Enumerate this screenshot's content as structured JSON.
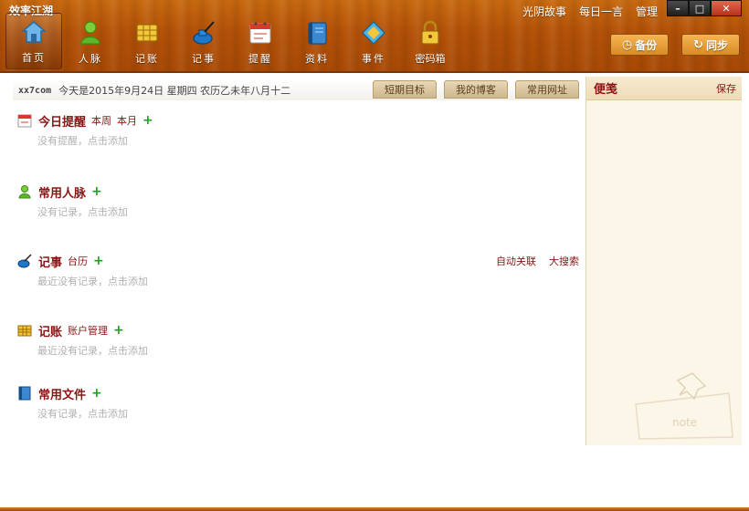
{
  "app": {
    "title": "效率江湖"
  },
  "top_links": [
    "光阴故事",
    "每日一言",
    "管理"
  ],
  "window_controls": {
    "minimize": "–",
    "maximize": "□",
    "close": "✕"
  },
  "nav": [
    {
      "label": "首页",
      "icon": "home-icon"
    },
    {
      "label": "人脉",
      "icon": "contacts-person-icon"
    },
    {
      "label": "记账",
      "icon": "ledger-icon"
    },
    {
      "label": "记事",
      "icon": "ink-bottle-icon"
    },
    {
      "label": "提醒",
      "icon": "calendar-icon"
    },
    {
      "label": "资料",
      "icon": "book-icon"
    },
    {
      "label": "事件",
      "icon": "diamond-icon"
    },
    {
      "label": "密码箱",
      "icon": "lock-icon"
    }
  ],
  "actions": {
    "backup": "备份",
    "sync": "同步"
  },
  "info": {
    "user": "xx7com",
    "date_text": "今天是2015年9月24日 星期四 农历乙未年八月十二"
  },
  "tabs": [
    "短期目标",
    "我的博客",
    "常用网址"
  ],
  "sections": {
    "reminder": {
      "title": "今日提醒",
      "links": [
        "本周",
        "本月"
      ],
      "empty": "没有提醒，点击添加"
    },
    "contacts": {
      "title": "常用人脉",
      "empty": "没有记录，点击添加"
    },
    "notes": {
      "title": "记事",
      "link": "台历",
      "empty": "最近没有记录，点击添加",
      "right_links": [
        "自动关联",
        "大搜索"
      ]
    },
    "accounts": {
      "title": "记账",
      "link": "账户管理",
      "empty": "最近没有记录，点击添加"
    },
    "files": {
      "title": "常用文件",
      "empty": "没有记录，点击添加"
    }
  },
  "memo": {
    "title": "便笺",
    "save": "保存",
    "deco_text": "note"
  },
  "colors": {
    "wood": "#b45208",
    "accent_red": "#8b1414",
    "plus_green": "#1aa01a"
  }
}
